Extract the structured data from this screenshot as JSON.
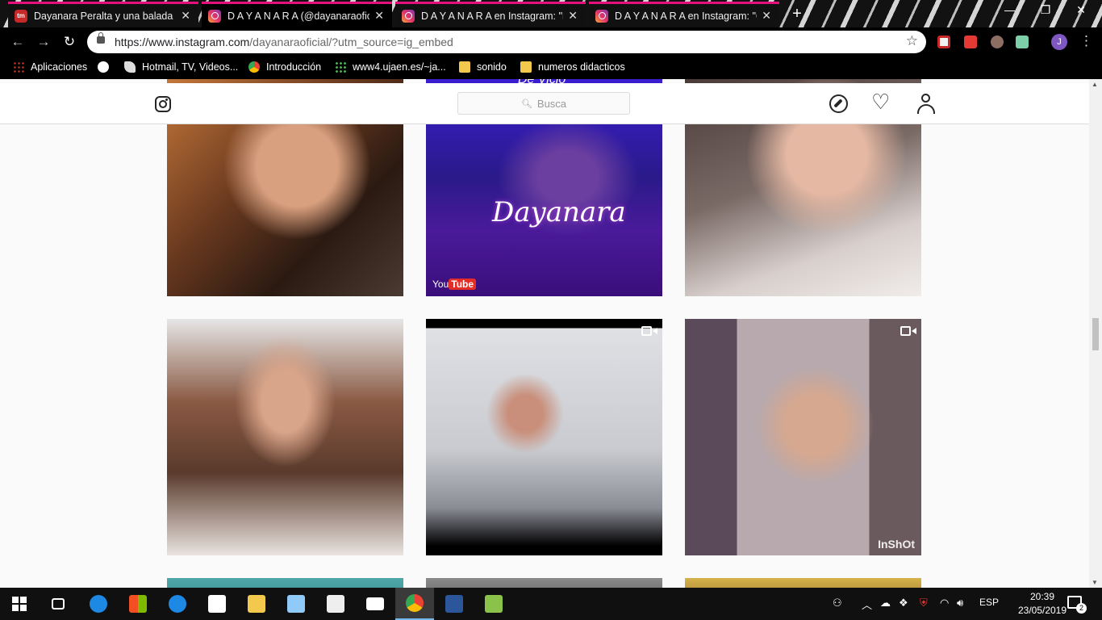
{
  "browser": {
    "tabs": [
      {
        "title": "Dayanara Peralta y una balada pa",
        "favicon": "news-icon"
      },
      {
        "title": "D A Y A N A R A (@dayanaraofici",
        "favicon": "instagram-icon"
      },
      {
        "title": "D A Y A N A R A en Instagram: \"F",
        "favicon": "instagram-icon"
      },
      {
        "title": "D A Y A N A R A en Instagram: \"C",
        "favicon": "instagram-icon"
      }
    ],
    "url_domain": "https://www.instagram.com",
    "url_rest": "/dayanaraoficial/?utm_source=ig_embed",
    "profile_initial": "J",
    "bookmarks": [
      {
        "label": "Aplicaciones",
        "icon": "apps-icon"
      },
      {
        "label": "",
        "icon": "globe-icon"
      },
      {
        "label": "Hotmail, TV, Videos...",
        "icon": "feather-icon"
      },
      {
        "label": "Introducción",
        "icon": "chrome-icon"
      },
      {
        "label": "www4.ujaen.es/~ja...",
        "icon": "dots-icon"
      },
      {
        "label": "sonido",
        "icon": "folder-icon"
      },
      {
        "label": "numeros didacticos",
        "icon": "folder-icon"
      }
    ]
  },
  "instagram": {
    "search_placeholder": "Busca",
    "posts": [
      {
        "alt": "post-1"
      },
      {
        "alt": "post-2",
        "overlay_text": "Dayanara",
        "top_caption": "De Vicio",
        "yt_left": "You",
        "yt_right": "Tube"
      },
      {
        "alt": "post-3"
      },
      {
        "alt": "post-4"
      },
      {
        "alt": "post-5",
        "video": true
      },
      {
        "alt": "post-6",
        "video": true,
        "watermark": "InShOt"
      },
      {
        "alt": "post-7"
      },
      {
        "alt": "post-8"
      },
      {
        "alt": "post-9"
      }
    ]
  },
  "taskbar": {
    "language": "ESP",
    "time": "20:39",
    "date": "23/05/2019",
    "notifications": "2"
  }
}
